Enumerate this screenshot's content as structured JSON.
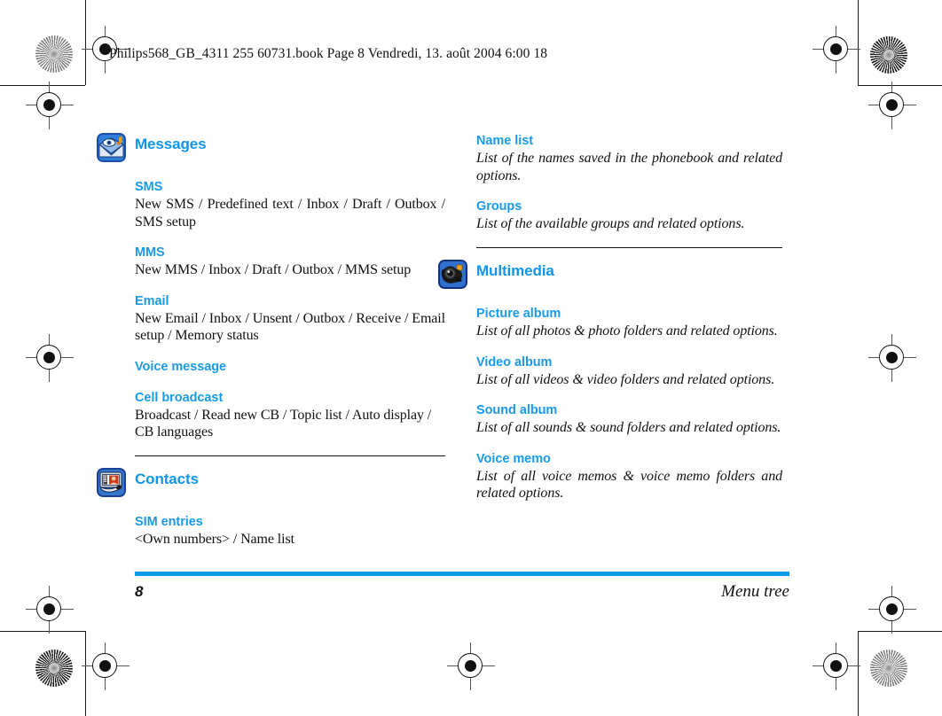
{
  "header": {
    "stamp": "Philips568_GB_4311 255 60731.book  Page 8  Vendredi, 13. août 2004  6:00 18"
  },
  "footer": {
    "page_number": "8",
    "label": "Menu tree",
    "bar_color": "#0a9ae8"
  },
  "colors": {
    "heading_blue": "#1a9ae8",
    "section_blue": "#0f96e6",
    "text_black": "#111111"
  },
  "left_column": {
    "sections": [
      {
        "icon": "messages-envelope-icon",
        "title": "Messages",
        "entries": [
          {
            "title": "SMS",
            "body": "New SMS / Predefined text / Inbox / Draft / Outbox / SMS setup"
          },
          {
            "title": "MMS",
            "body": "New MMS / Inbox / Draft / Outbox / MMS setup"
          },
          {
            "title": "Email",
            "body": "New Email / Inbox / Unsent / Outbox / Receive / Email setup / Memory status"
          },
          {
            "title": "Voice message",
            "body": ""
          },
          {
            "title": "Cell broadcast",
            "body": "Broadcast / Read new CB / Topic list / Auto display / CB languages"
          }
        ]
      },
      {
        "icon": "contacts-screen-icon",
        "title": "Contacts",
        "entries": [
          {
            "title": "SIM entries",
            "body": "<Own numbers> / Name list"
          }
        ]
      }
    ]
  },
  "right_column": {
    "top_entries": [
      {
        "title": "Name list",
        "body": "List of the names saved in the phonebook and related options."
      },
      {
        "title": "Groups",
        "body": "List of the available groups and related options."
      }
    ],
    "sections": [
      {
        "icon": "multimedia-camera-icon",
        "title": "Multimedia",
        "entries": [
          {
            "title": "Picture album",
            "body": "List of all photos & photo folders and related options."
          },
          {
            "title": "Video album",
            "body": "List of all videos & video folders and related options."
          },
          {
            "title": "Sound album",
            "body": "List of all sounds & sound folders and related options."
          },
          {
            "title": "Voice memo",
            "body": "List of all voice memos & voice memo folders and related options."
          }
        ]
      }
    ]
  },
  "print_marks": {
    "registration": "registration-crosshair-mark",
    "resolution": "starburst-resolution-target"
  }
}
